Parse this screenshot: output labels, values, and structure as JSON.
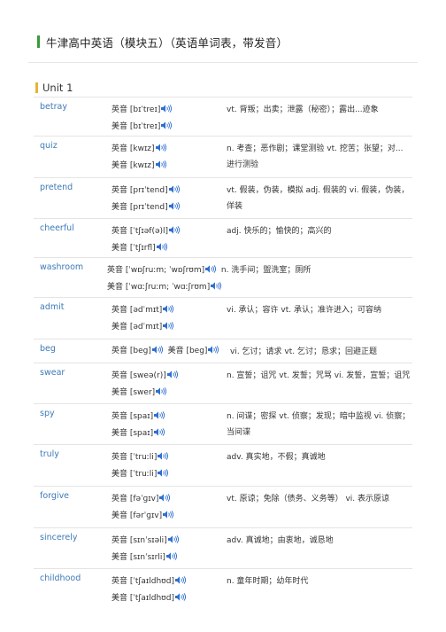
{
  "document": {
    "title": "牛津高中英语（模块五）（英语单词表，带发音）",
    "unit": "Unit 1"
  },
  "colors": {
    "title_bar": "#3a9a3a",
    "unit_bar": "#e8b23a",
    "word": "#3d7ab8",
    "speaker": "#2f6fd1"
  },
  "icons": {
    "audio": "speaker-icon"
  },
  "entries": [
    {
      "word": "betray",
      "uk": "英音 [bɪˈtreɪ]",
      "us": "美音 [bɪˈtreɪ]",
      "meaning": "vt. 背叛；出卖；泄露（秘密）；露出...迹象"
    },
    {
      "word": "quiz",
      "uk": "英音 [kwɪz]",
      "us": "美音 [kwɪz]",
      "meaning": "n. 考查；恶作剧；课堂测验 vt. 挖苦；张望；对...进行测验"
    },
    {
      "word": "pretend",
      "uk": "英音 [prɪˈtend]",
      "us": "美音 [prɪˈtend]",
      "meaning": "vt. 假装，伪装，模拟 adj. 假装的 vi. 假装，伪装，佯装"
    },
    {
      "word": "cheerful",
      "uk": "英音 [ˈtʃɪəf(ə)l]",
      "us": "美音 [ˈtʃɪrfl]",
      "meaning": "adj. 快乐的；愉快的；高兴的"
    },
    {
      "word": "washroom",
      "uk": "英音 [ˈwɒʃruːm; ˈwɒʃrʊm]",
      "us": "美音 [ˈwɑːʃruːm; ˈwɑːʃrʊm]",
      "meaning": "n. 洗手间；盥洗室；厕所"
    },
    {
      "word": "admit",
      "uk": "英音 [ədˈmɪt]",
      "us": "美音 [ədˈmɪt]",
      "meaning": "vi. 承认；容许 vt. 承认；准许进入；可容纳"
    },
    {
      "word": "beg",
      "uk": "英音 [beg]",
      "us": "美音 [beg]",
      "meaning": "vi. 乞讨；请求 vt. 乞讨；恳求；回避正题"
    },
    {
      "word": "swear",
      "uk": "英音 [sweə(r)]",
      "us": "美音 [swer]",
      "meaning": "n. 宣誓；诅咒 vt. 发誓；咒骂 vi. 发誓，宣誓；诅咒"
    },
    {
      "word": "spy",
      "uk": "英音 [spaɪ]",
      "us": "美音 [spaɪ]",
      "meaning": "n. 间谍；密探 vt. 侦察；发现；暗中监视 vi. 侦察；当间谍"
    },
    {
      "word": "truly",
      "uk": "英音 [ˈtruːli]",
      "us": "美音 [ˈtruːli]",
      "meaning": "adv. 真实地，不假；真诚地"
    },
    {
      "word": "forgive",
      "uk": "英音 [fəˈɡɪv]",
      "us": "美音 [fərˈɡɪv]",
      "meaning": "vt. 原谅；免除（债务、义务等） vi. 表示原谅"
    },
    {
      "word": "sincerely",
      "uk": "英音 [sɪnˈsɪəli]",
      "us": "美音 [sɪnˈsɪrli]",
      "meaning": "adv. 真诚地；由衷地，诚恳地"
    },
    {
      "word": "childhood",
      "uk": "英音 [ˈtʃaɪldhʊd]",
      "us": "美音 [ˈtʃaɪldhʊd]",
      "meaning": "n. 童年时期；幼年时代"
    }
  ]
}
